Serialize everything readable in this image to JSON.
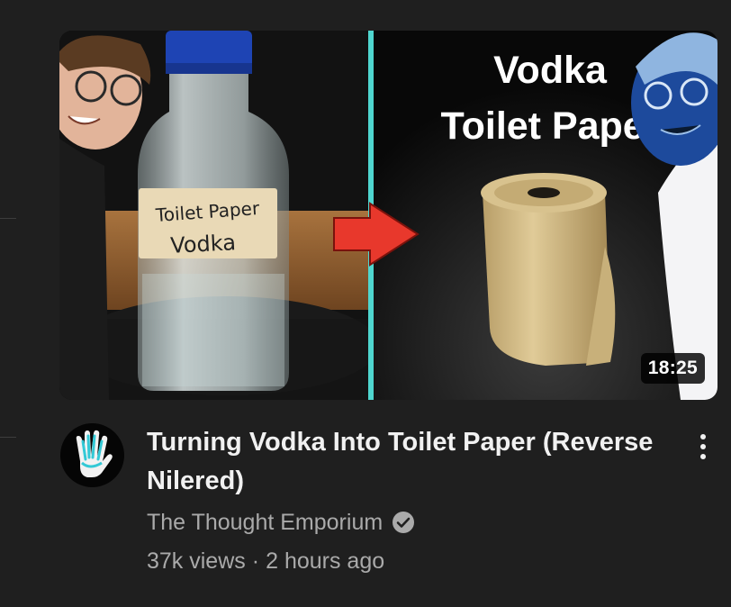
{
  "video": {
    "duration": "18:25",
    "title": "Turning Vodka Into Toilet Paper (Reverse Nilered)",
    "channel": "The Thought Emporium",
    "views": "37k views",
    "separator": "·",
    "age": "2 hours ago"
  },
  "thumbnail": {
    "label_line1": "Toilet Paper",
    "label_line2": "Vodka",
    "heading_line1": "Vodka",
    "heading_line2": "Toilet Paper"
  },
  "icons": {
    "verified": "check-circle-icon",
    "menu": "more-vertical-icon",
    "avatar": "hand-logo-icon"
  },
  "colors": {
    "divider": "#4fd6cf",
    "arrow": "#e8382c",
    "background": "#1f1f1f",
    "secondary_text": "#aaaaaa"
  }
}
